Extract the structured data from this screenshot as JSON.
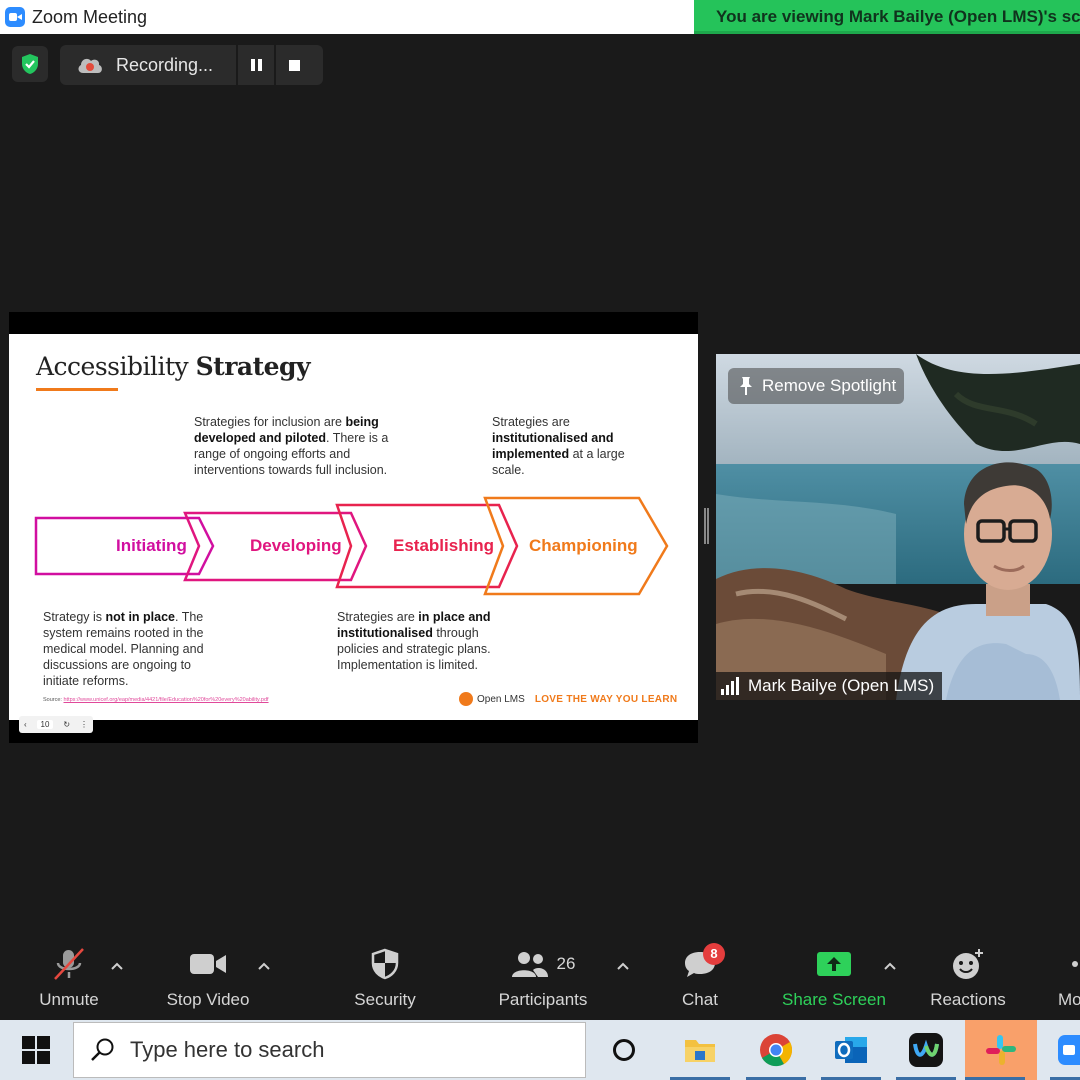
{
  "window": {
    "title": "Zoom Meeting",
    "viewing_banner": "You are viewing Mark Bailye (Open LMS)'s screen"
  },
  "recording": {
    "label": "Recording...",
    "pause_label": "pause",
    "stop_label": "stop"
  },
  "slide": {
    "title_light": "Accessibility",
    "title_bold": "Strategy",
    "stages": [
      "Initiating",
      "Developing",
      "Establishing",
      "Championing"
    ],
    "stage_colors": [
      "#d10fa0",
      "#e0167f",
      "#e8234e",
      "#f07a1b"
    ],
    "desc_developing": {
      "pre": "Strategies for inclusion are ",
      "bold": "being developed and piloted",
      "post": ". There is a range of ongoing efforts and interventions towards full inclusion."
    },
    "desc_championing": {
      "pre": "Strategies are ",
      "bold": "institutionalised and implemented",
      "post": " at a large scale."
    },
    "desc_initiating": {
      "pre": "Strategy is ",
      "bold": "not in place",
      "post": ". The system remains rooted in the medical model. Planning and discussions are ongoing to initiate reforms."
    },
    "desc_establishing": {
      "pre": "Strategies are ",
      "bold": "in place and institutionalised",
      "post": " through policies and strategic plans. Implementation is limited."
    },
    "source_label": "Source:",
    "source_url": "https://www.unicef.org/eap/media/4421/file/Education%20for%20every%20ability.pdf",
    "brand_name": "Open LMS",
    "brand_tagline": "LOVE THE WAY YOU LEARN",
    "page_number": "10"
  },
  "video": {
    "spotlight_label": "Remove Spotlight",
    "participant_name": "Mark Bailye (Open LMS)"
  },
  "toolbar": {
    "unmute": "Unmute",
    "stop_video": "Stop Video",
    "security": "Security",
    "participants": "Participants",
    "participants_count": "26",
    "chat": "Chat",
    "chat_badge": "8",
    "share_screen": "Share Screen",
    "reactions": "Reactions",
    "more": "More",
    "share_color": "#2ed15a"
  },
  "taskbar": {
    "search_placeholder": "Type here to search",
    "apps": [
      "cortana-icon",
      "file-explorer-icon",
      "chrome-icon",
      "outlook-icon",
      "webex-icon",
      "slack-icon",
      "zoom-icon"
    ]
  }
}
